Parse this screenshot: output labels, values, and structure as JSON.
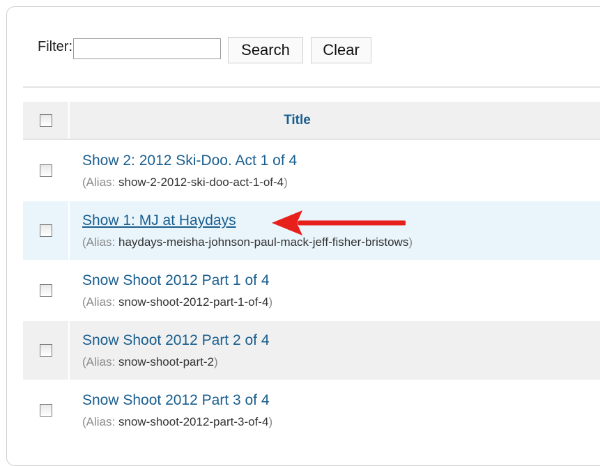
{
  "filter": {
    "label": "Filter:",
    "value": "",
    "placeholder": "",
    "search_label": "Search",
    "clear_label": "Clear"
  },
  "table": {
    "header_title": "Title",
    "alias_label": "Alias",
    "rows": [
      {
        "title": "Show 2: 2012 Ski-Doo. Act 1 of 4",
        "alias": "show-2-2012-ski-doo-act-1-of-4"
      },
      {
        "title": "Show 1: MJ at Haydays",
        "alias": "haydays-meisha-johnson-paul-mack-jeff-fisher-bristows"
      },
      {
        "title": "Snow Shoot 2012 Part 1 of 4",
        "alias": "snow-shoot-2012-part-1-of-4"
      },
      {
        "title": "Snow Shoot 2012 Part 2 of 4",
        "alias": "snow-shoot-part-2"
      },
      {
        "title": "Snow Shoot 2012 Part 3 of 4",
        "alias": "snow-shoot-2012-part-3-of-4"
      }
    ]
  },
  "colors": {
    "link": "#1a5e8e",
    "highlight_row": "#e9f5fb",
    "arrow": "#e8201c"
  }
}
